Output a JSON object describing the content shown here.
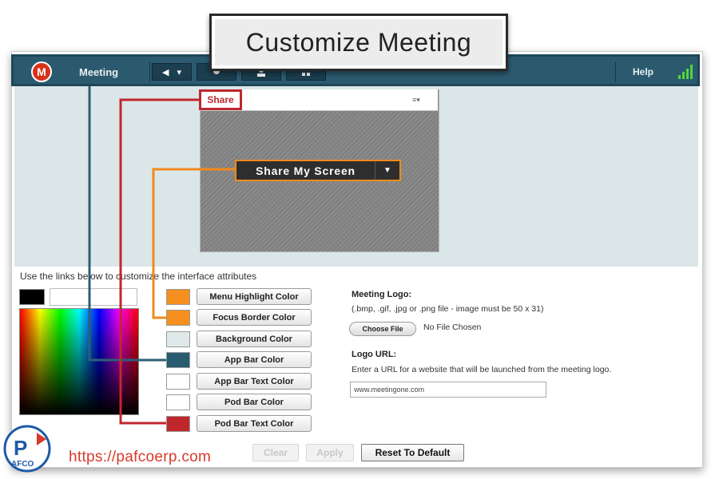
{
  "callout": {
    "title": "Customize Meeting"
  },
  "appbar": {
    "logo_letter": "M",
    "meeting_label": "Meeting",
    "speaker_glyph": "◀",
    "dropdown_glyph": "▾",
    "help_label": "Help",
    "icons": [
      "speaker-icon",
      "webcam-icon",
      "people-icon",
      "grid-icon",
      "signal-icon"
    ]
  },
  "pod": {
    "title": "Share",
    "menu_glyph": "≡▾",
    "share_button": "Share My Screen",
    "share_dropdown_glyph": "▼"
  },
  "customize": {
    "instructions": "Use the links below to customize the interface attributes",
    "attributes": [
      {
        "label": "Menu Highlight Color",
        "color": "#f5901f"
      },
      {
        "label": "Focus Border Color",
        "color": "#f5901f"
      },
      {
        "label": "Background Color",
        "color": "#dfe9ea"
      },
      {
        "label": "App Bar Color",
        "color": "#285a70"
      },
      {
        "label": "App Bar Text Color",
        "color": "#ffffff"
      },
      {
        "label": "Pod Bar Color",
        "color": "#ffffff"
      },
      {
        "label": "Pod Bar Text Color",
        "color": "#c0272d"
      }
    ]
  },
  "logo_section": {
    "label": "Meeting Logo:",
    "hint": "(.bmp, .gif, .jpg or .png file - image must be 50 x 31)",
    "choose_button": "Choose File",
    "file_status": "No File Chosen"
  },
  "url_section": {
    "label": "Logo URL:",
    "description": "Enter a URL for a website that will be launched from the meeting logo.",
    "value": "www.meetingone.com"
  },
  "buttons": {
    "clear": "Clear",
    "apply": "Apply",
    "reset": "Reset To Default"
  },
  "watermark": {
    "url": "https://pafcoerp.com",
    "brand": "AFCO",
    "letter": "P"
  },
  "colors": {
    "appbar": "#2b5a6f",
    "stage_bg": "#dbe6e8",
    "accent_orange": "#f08a1d",
    "accent_red": "#c0272d",
    "leader_blue": "#2c5f75"
  }
}
